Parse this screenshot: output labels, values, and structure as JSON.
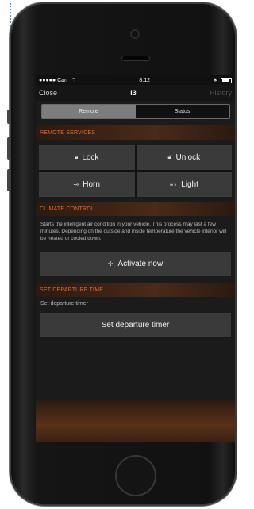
{
  "statusbar": {
    "carrier": "●●●●● Carr",
    "wifi": "⌔",
    "time": "8:12",
    "bt": "∗"
  },
  "navbar": {
    "close": "Close",
    "title": "i3",
    "history": "History"
  },
  "tabs": {
    "remote": "Remote",
    "status": "Status"
  },
  "remote_services": {
    "header": "REMOTE SERVICES",
    "lock": "Lock",
    "unlock": "Unlock",
    "horn": "Horn",
    "light": "Light"
  },
  "climate": {
    "header": "CLIMATE CONTROL",
    "description": "Starts the intelligent air condition in your vehicle. This process may last a few minutes. Depending on the outside and inside temperature the vehicle interior will be heated or cooled down.",
    "button": "Activate now"
  },
  "departure": {
    "header": "SET DEPARTURE TIME",
    "subtitle": "Set departure timer",
    "button": "Set departure timer"
  },
  "colors": {
    "accent": "#e36b2a",
    "button_bg": "#3a3a3a",
    "screen_bg": "#1b1b1b"
  }
}
